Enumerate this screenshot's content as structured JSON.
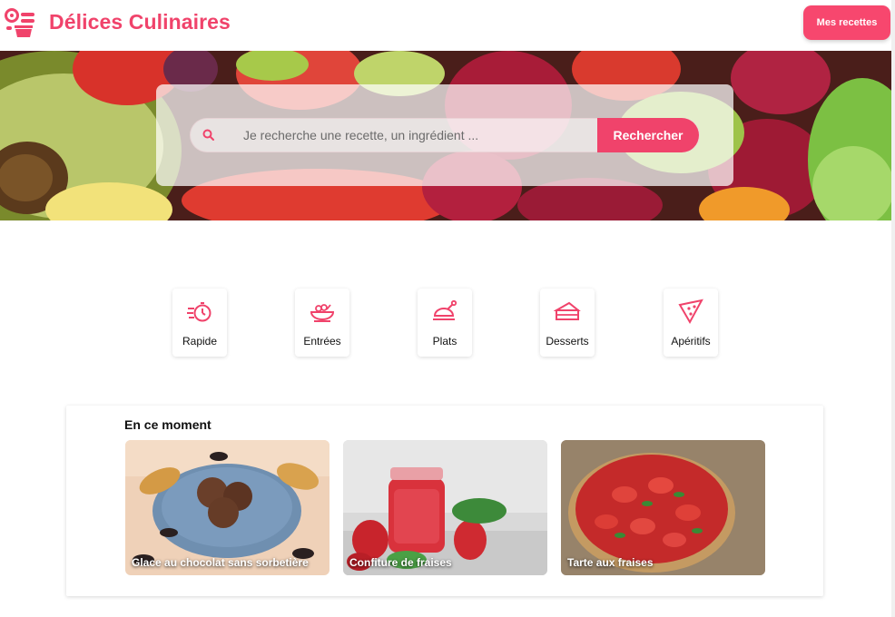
{
  "header": {
    "brand": "Délices Culinaires",
    "my_recipes_label": "Mes recettes",
    "accent_color": "#f0436b"
  },
  "search": {
    "placeholder": "Je recherche une recette, un ingrédient ...",
    "button_label": "Rechercher"
  },
  "categories": [
    {
      "label": "Rapide",
      "icon": "stopwatch-icon"
    },
    {
      "label": "Entrées",
      "icon": "salad-bowl-icon"
    },
    {
      "label": "Plats",
      "icon": "roast-chicken-icon"
    },
    {
      "label": "Desserts",
      "icon": "cake-slice-icon"
    },
    {
      "label": "Apéritifs",
      "icon": "tortilla-chip-icon"
    }
  ],
  "moment": {
    "title": "En ce moment",
    "recipes": [
      {
        "title": "Glace au chocolat sans sorbetière"
      },
      {
        "title": "Confiture de fraises"
      },
      {
        "title": "Tarte aux fraises"
      }
    ]
  }
}
